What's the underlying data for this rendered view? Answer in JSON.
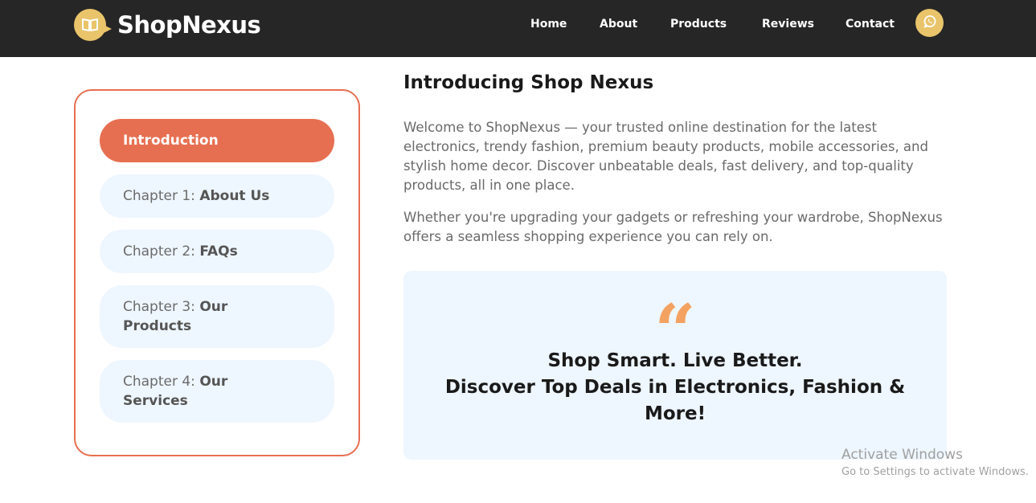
{
  "brand": {
    "name": "ShopNexus",
    "logo_icon": "book-icon",
    "accent": "#e9c46a"
  },
  "nav": {
    "items": [
      {
        "label": "Home"
      },
      {
        "label": "About"
      },
      {
        "label": "Products"
      },
      {
        "label": "Reviews"
      },
      {
        "label": "Contact"
      }
    ],
    "whatsapp_icon": "whatsapp-icon"
  },
  "sidebar": {
    "accent": "#e76f51",
    "items": [
      {
        "prefix": "",
        "label": "Introduction",
        "active": true
      },
      {
        "prefix": "Chapter 1: ",
        "label": "About Us",
        "active": false
      },
      {
        "prefix": "Chapter 2: ",
        "label": "FAQs",
        "active": false
      },
      {
        "prefix": "Chapter 3: ",
        "label": "Our Products",
        "active": false
      },
      {
        "prefix": "Chapter 4: ",
        "label": "Our Services",
        "active": false
      }
    ]
  },
  "main": {
    "title": "Introducing Shop Nexus",
    "paragraph1": "Welcome to ShopNexus — your trusted online destination for the latest electronics, trendy fashion, premium beauty products, mobile accessories, and stylish home decor. Discover unbeatable deals, fast delivery, and top-quality products, all in one place.",
    "paragraph2": "Whether you're upgrading your gadgets or refreshing your wardrobe, ShopNexus offers a seamless shopping experience you can rely on.",
    "quote": {
      "mark": "“",
      "line1": "Shop Smart. Live Better.",
      "line2": "Discover Top Deals in Electronics, Fashion & More!",
      "mark_color": "#f4a261"
    }
  },
  "watermark": {
    "title": "Activate Windows",
    "subtitle": "Go to Settings to activate Windows."
  }
}
